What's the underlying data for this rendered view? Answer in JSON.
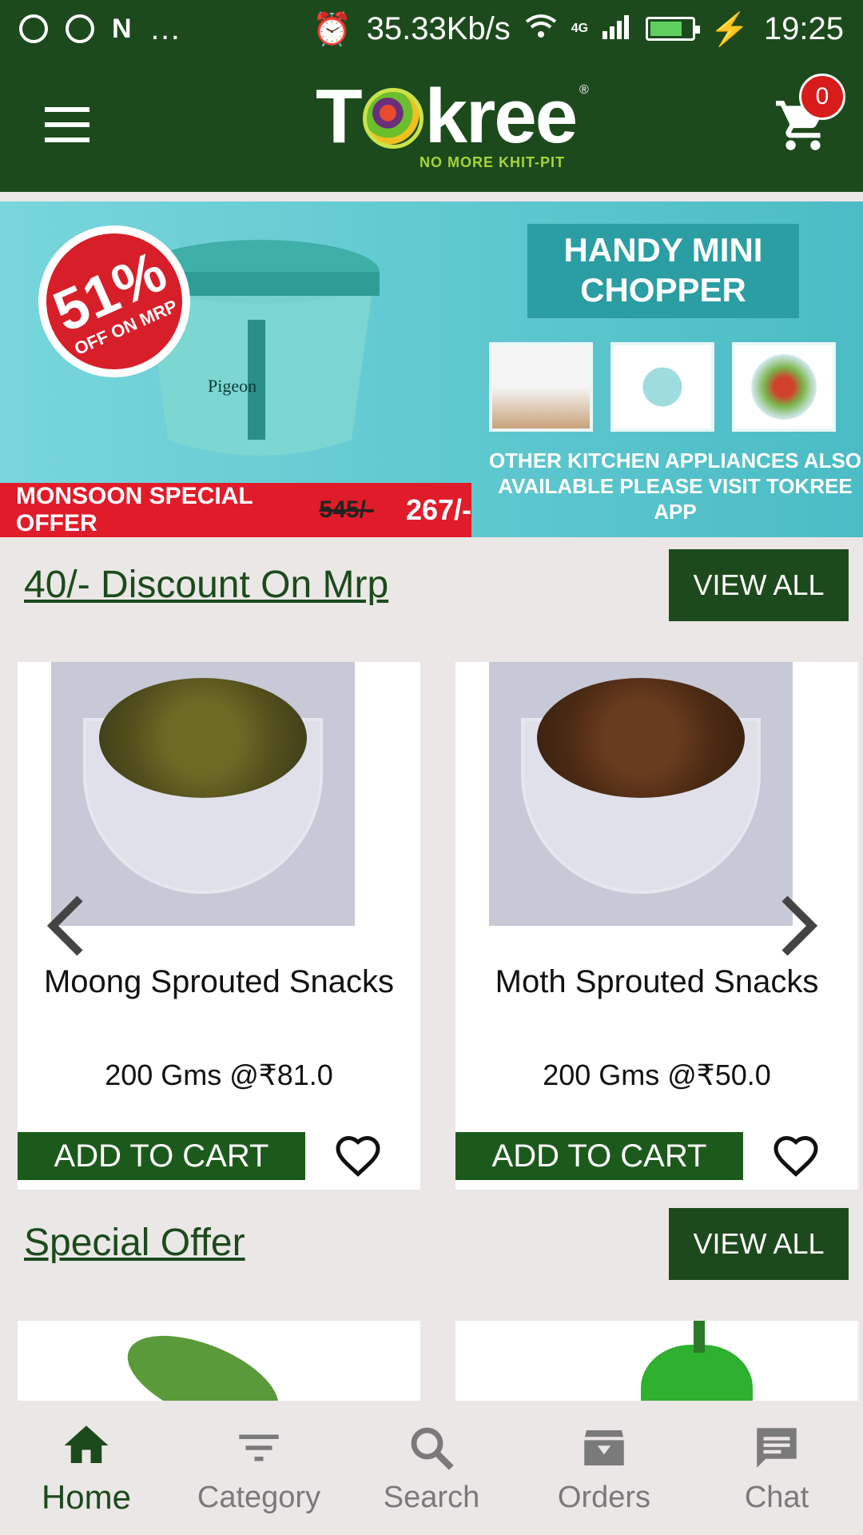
{
  "status_bar": {
    "speed": "35.33Kb/s",
    "time": "19:25",
    "more": "…",
    "network": "4G"
  },
  "app": {
    "logo_text": "Tokree",
    "logo_tagline": "NO MORE KHIT-PIT",
    "cart_count": "0",
    "colors": {
      "primary": "#1c4a1c",
      "badge": "#d81b1b"
    }
  },
  "banner": {
    "discount": "51%",
    "discount_sub": "OFF ON MRP",
    "brand_on_product": "Pigeon",
    "headline": "HANDY MINI CHOPPER",
    "offer_label": "MONSOON SPECIAL OFFER",
    "old_price": "545/-",
    "new_price": "267/-",
    "appliances_note": "OTHER KITCHEN APPLIANCES ALSO AVAILABLE PLEASE VISIT TOKREE APP"
  },
  "sections": [
    {
      "title": "40/- Discount On Mrp",
      "view_all": "VIEW ALL",
      "products": [
        {
          "name": "Moong Sprouted Snacks",
          "price": "200 Gms @₹81.0",
          "add_to_cart": "ADD TO CART"
        },
        {
          "name": "Moth Sprouted Snacks",
          "price": "200 Gms @₹50.0",
          "add_to_cart": "ADD TO CART"
        }
      ]
    },
    {
      "title": "Special Offer",
      "view_all": "VIEW ALL"
    }
  ],
  "bottom_nav": [
    {
      "label": "Home",
      "icon": "home-icon",
      "active": true
    },
    {
      "label": "Category",
      "icon": "filter-icon",
      "active": false
    },
    {
      "label": "Search",
      "icon": "search-icon",
      "active": false
    },
    {
      "label": "Orders",
      "icon": "orders-box-icon",
      "active": false
    },
    {
      "label": "Chat",
      "icon": "chat-icon",
      "active": false
    }
  ]
}
